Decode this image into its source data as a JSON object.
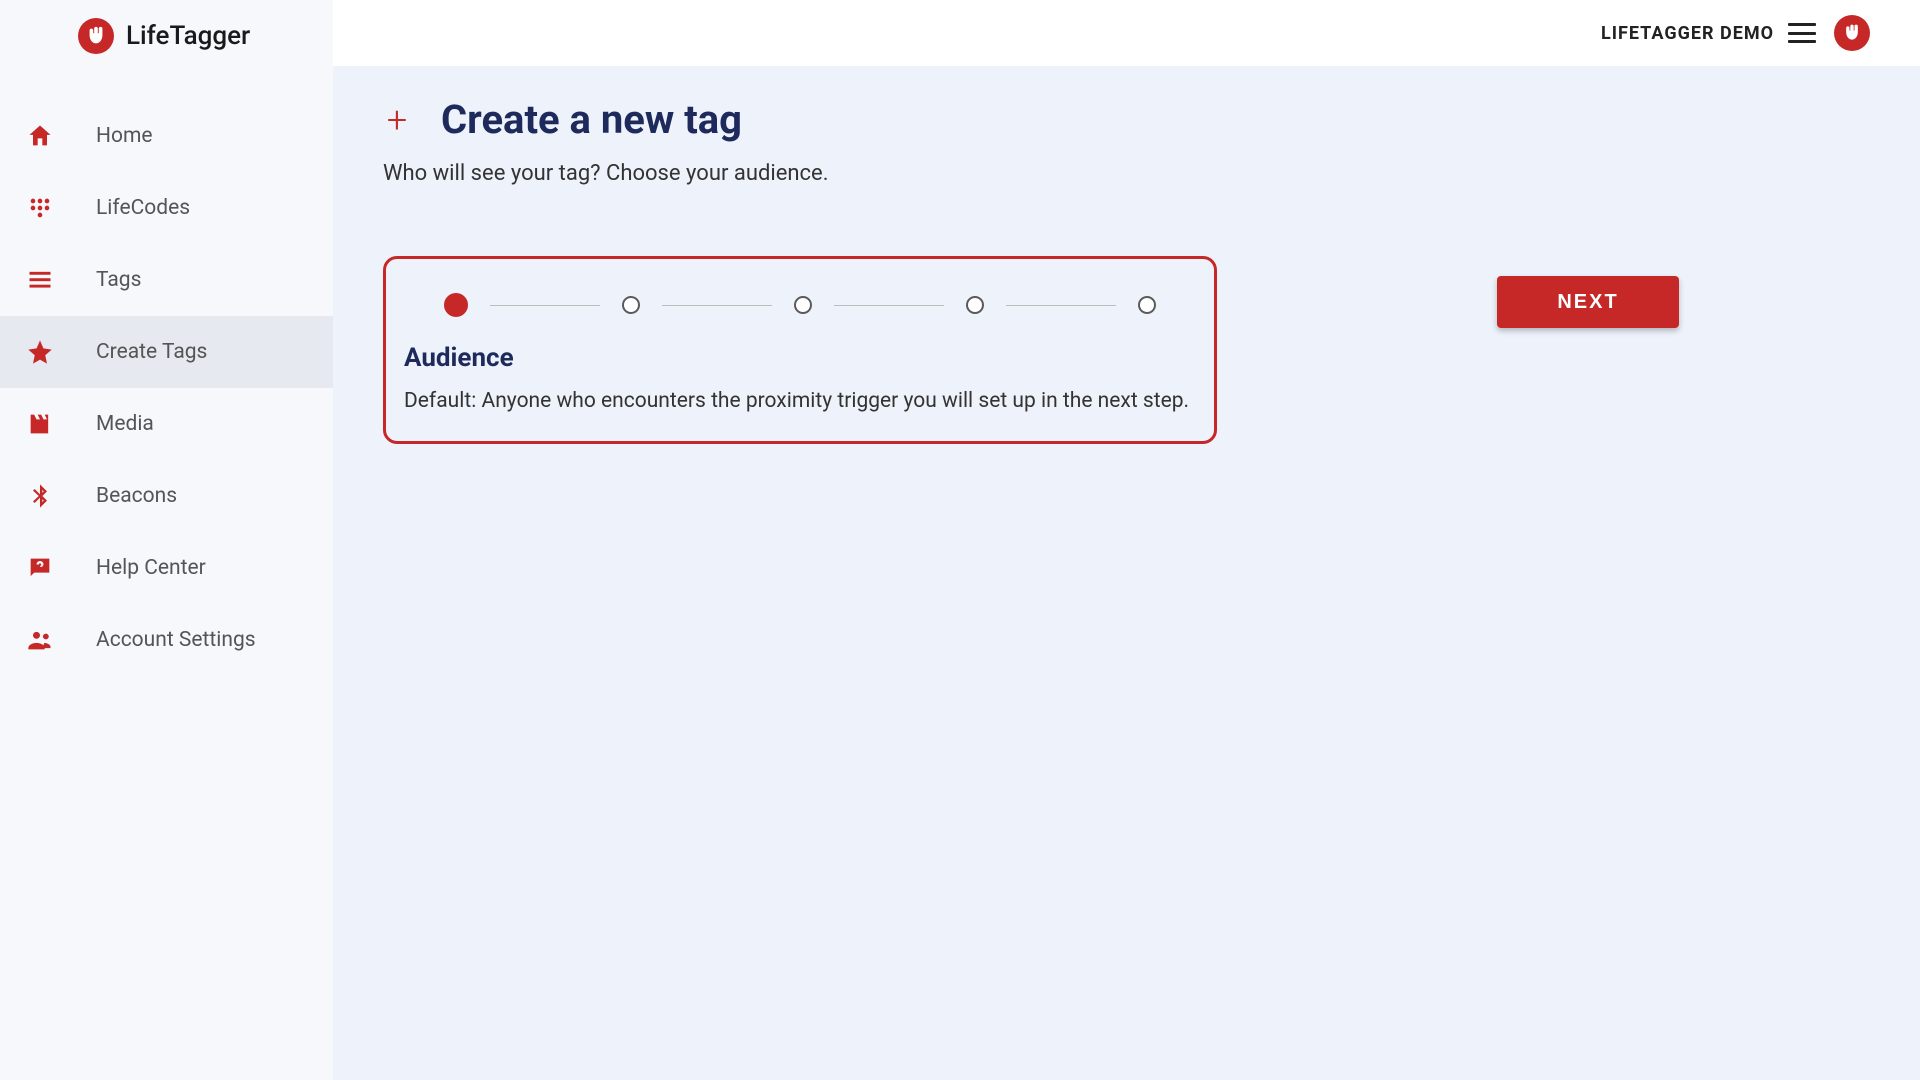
{
  "brand": {
    "name": "LifeTagger"
  },
  "topbar": {
    "account_label": "LIFETAGGER DEMO"
  },
  "sidebar": {
    "items": [
      {
        "label": "Home",
        "icon": "home-icon"
      },
      {
        "label": "LifeCodes",
        "icon": "dialpad-icon"
      },
      {
        "label": "Tags",
        "icon": "list-icon"
      },
      {
        "label": "Create Tags",
        "icon": "star-icon",
        "active": true
      },
      {
        "label": "Media",
        "icon": "movie-icon"
      },
      {
        "label": "Beacons",
        "icon": "bluetooth-icon"
      },
      {
        "label": "Help Center",
        "icon": "help-icon"
      },
      {
        "label": "Account Settings",
        "icon": "people-icon"
      }
    ]
  },
  "page": {
    "title": "Create a new tag",
    "subtitle": "Who will see your tag? Choose your audience."
  },
  "wizard": {
    "step_count": 5,
    "current_step": 1,
    "card_title": "Audience",
    "card_desc": "Default: Anyone who encounters the proximity trigger you will set up in the next step.",
    "next_label": "NEXT"
  }
}
